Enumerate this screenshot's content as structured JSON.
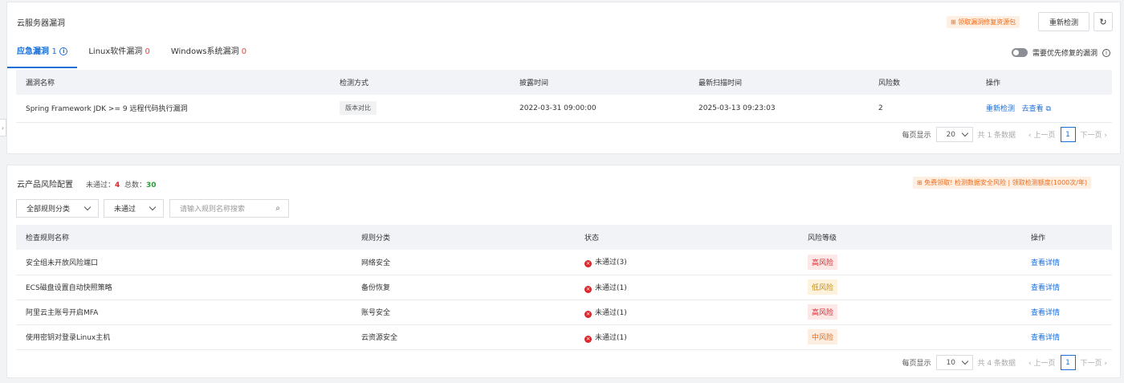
{
  "vuln": {
    "title": "云服务器漏洞",
    "promo": "领取漏洞修复资源包",
    "recheck_btn": "重新检测",
    "tabs": [
      {
        "label": "应急漏洞",
        "count": "1"
      },
      {
        "label": "Linux软件漏洞",
        "count": "0"
      },
      {
        "label": "Windows系统漏洞",
        "count": "0"
      }
    ],
    "toggle_label": "需要优先修复的漏洞",
    "columns": [
      "漏洞名称",
      "检测方式",
      "披露时间",
      "最新扫描时间",
      "风险数",
      "操作"
    ],
    "rows": [
      {
        "name": "Spring Framework JDK >= 9 远程代码执行漏洞",
        "method": "版本对比",
        "disclosed": "2022-03-31 09:00:00",
        "scanned": "2025-03-13 09:23:03",
        "risks": "2",
        "action1": "重新检测",
        "action2": "去查看"
      }
    ],
    "pager": {
      "per_page_label": "每页显示",
      "per_page": "20",
      "total": "共 1 条数据",
      "prev": "上一页",
      "page": "1",
      "next": "下一页"
    }
  },
  "config": {
    "title": "云产品风险配置",
    "failed_label": "未通过：",
    "failed_count": "4",
    "total_label": "总数：",
    "total_count": "30",
    "promo": "免费领取! 检测数据安全风险 | 领取检测额度(1000次/年)",
    "filter_category": "全部规则分类",
    "filter_status": "未通过",
    "search_placeholder": "请输入规则名称搜索",
    "columns": [
      "检查规则名称",
      "规则分类",
      "状态",
      "风险等级",
      "操作"
    ],
    "rows": [
      {
        "name": "安全组未开放风险端口",
        "category": "网络安全",
        "status": "未通过(3)",
        "level": "高风险",
        "action": "查看详情"
      },
      {
        "name": "ECS磁盘设置自动快照策略",
        "category": "备份恢复",
        "status": "未通过(1)",
        "level": "低风险",
        "action": "查看详情"
      },
      {
        "name": "阿里云主账号开启MFA",
        "category": "账号安全",
        "status": "未通过(1)",
        "level": "高风险",
        "action": "查看详情"
      },
      {
        "name": "使用密钥对登录Linux主机",
        "category": "云资源安全",
        "status": "未通过(1)",
        "level": "中风险",
        "action": "查看详情"
      }
    ],
    "pager": {
      "per_page_label": "每页显示",
      "per_page": "10",
      "total": "共 4 条数据",
      "prev": "上一页",
      "page": "1",
      "next": "下一页"
    }
  },
  "colors": {
    "accent": "#1a6ed8",
    "high_bg": "#fde8e8",
    "high_fg": "#d9262a",
    "low_bg": "#fdf3dc",
    "low_fg": "#c98a10",
    "mid_bg": "#fdeee2",
    "mid_fg": "#e06b1c"
  }
}
